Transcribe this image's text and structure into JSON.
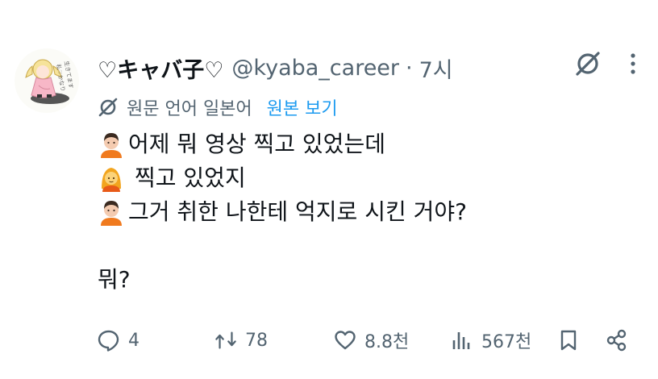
{
  "tweet": {
    "display_name": "♡キャバ子♡",
    "handle": "@kyaba_career",
    "separator": "·",
    "time": "7시"
  },
  "translation": {
    "source_language": "원문 언어 일본어",
    "show_original": "원본 보기"
  },
  "body": {
    "line1": "어제 뭐 영상 찍고 있었는데",
    "line2": "찍고 있었지",
    "line3": "그거 취한 나한테 억지로 시킨 거야?",
    "line4": "뭐?"
  },
  "actions": {
    "reply_count": "4",
    "retweet_count": "78",
    "like_count": "8.8천",
    "view_count": "567천"
  },
  "icons": {
    "avatar": "illustrated-girl-avatar",
    "grok": "grok-icon",
    "more": "more-vertical-icon",
    "translate": "translate-icon",
    "reply": "reply-icon",
    "retweet": "retweet-icon",
    "like": "heart-icon",
    "views": "views-icon",
    "bookmark": "bookmark-icon",
    "share": "share-icon"
  },
  "colors": {
    "text": "#0f1419",
    "secondary": "#536471",
    "link": "#1d9bf0"
  }
}
